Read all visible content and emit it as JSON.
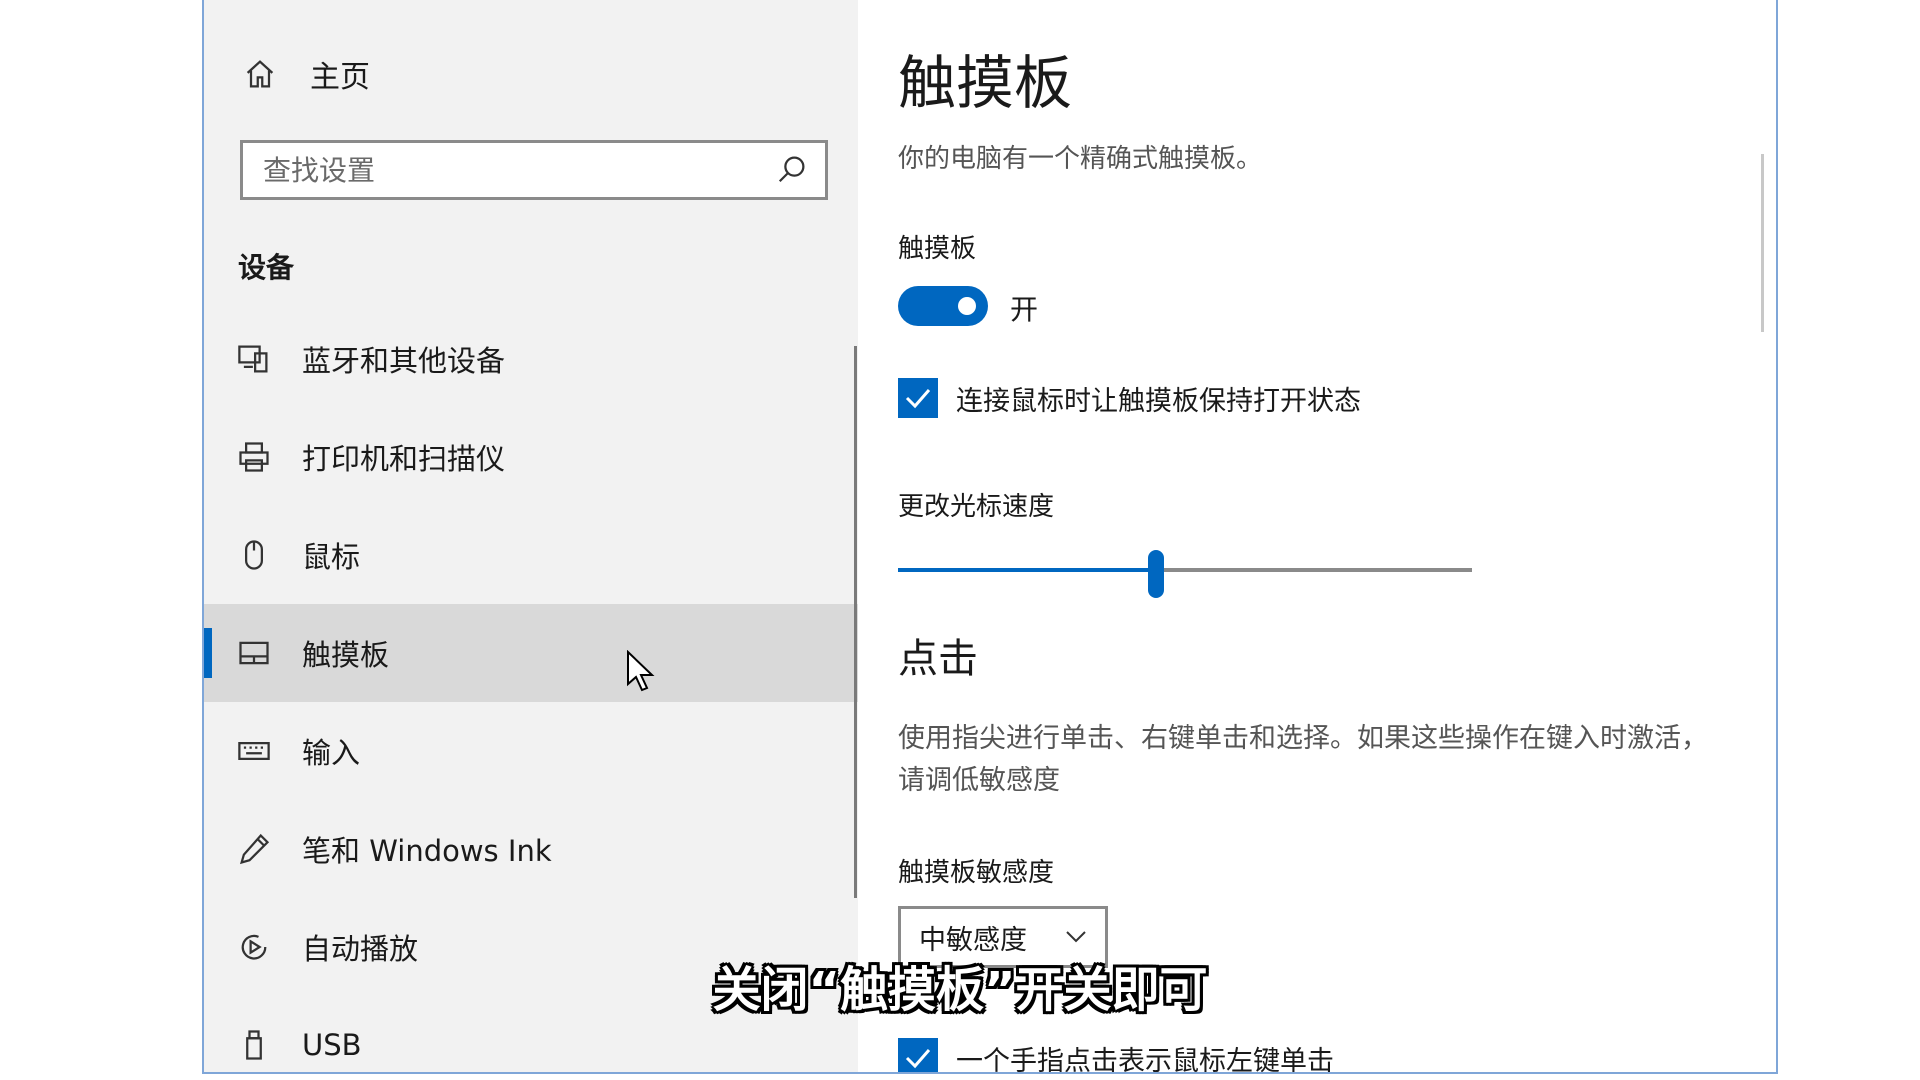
{
  "sidebar": {
    "home_label": "主页",
    "search_placeholder": "查找设置",
    "section_title": "设备",
    "items": [
      {
        "label": "蓝牙和其他设备",
        "icon": "bluetooth-devices-icon"
      },
      {
        "label": "打印机和扫描仪",
        "icon": "printer-icon"
      },
      {
        "label": "鼠标",
        "icon": "mouse-icon"
      },
      {
        "label": "触摸板",
        "icon": "touchpad-icon",
        "active": true
      },
      {
        "label": "输入",
        "icon": "keyboard-icon"
      },
      {
        "label": "笔和 Windows Ink",
        "icon": "pen-icon"
      },
      {
        "label": "自动播放",
        "icon": "autoplay-icon"
      },
      {
        "label": "USB",
        "icon": "usb-icon"
      }
    ]
  },
  "main": {
    "title": "触摸板",
    "description": "你的电脑有一个精确式触摸板。",
    "touchpad_label": "触摸板",
    "toggle_state": "开",
    "keep_on_with_mouse": "连接鼠标时让触摸板保持打开状态",
    "speed_label": "更改光标速度",
    "speed_value": 0.45,
    "taps_heading": "点击",
    "taps_description": "使用指尖进行单击、右键单击和选择。如果这些操作在键入时激活，请调低敏感度",
    "sensitivity_label": "触摸板敏感度",
    "sensitivity_value": "中敏感度",
    "single_tap_label": "一个手指点击表示鼠标左键单击"
  },
  "subtitle": "关闭“触摸板”开关即可",
  "colors": {
    "accent": "#0067c0",
    "sidebar_bg": "#f2f2f2",
    "active_bg": "#d9d9d9"
  }
}
